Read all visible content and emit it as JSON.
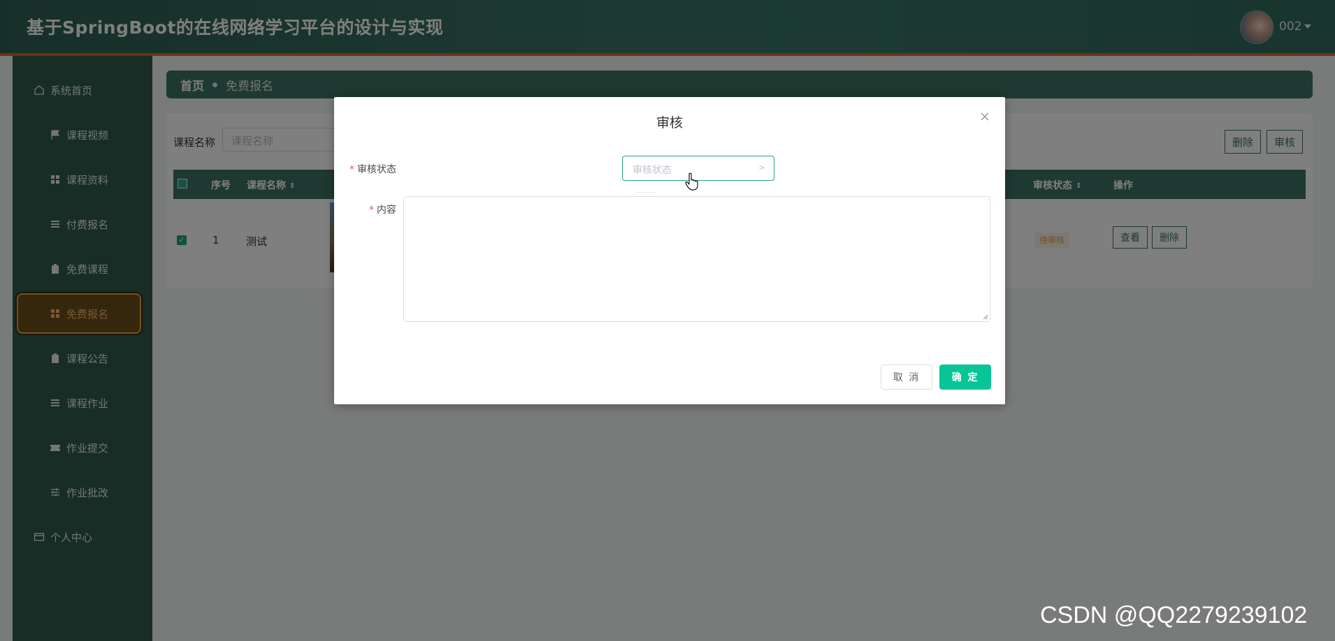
{
  "header": {
    "title": "基于SpringBoot的在线网络学习平台的设计与实现",
    "username": "002"
  },
  "sidebar": {
    "items": [
      {
        "label": "系统首页",
        "icon": "home-icon"
      },
      {
        "label": "课程视频",
        "icon": "flag-icon"
      },
      {
        "label": "课程资料",
        "icon": "grid-icon"
      },
      {
        "label": "付费报名",
        "icon": "list-icon"
      },
      {
        "label": "免费课程",
        "icon": "clipboard-icon"
      },
      {
        "label": "免费报名",
        "icon": "grid-icon",
        "active": true
      },
      {
        "label": "课程公告",
        "icon": "clipboard-icon"
      },
      {
        "label": "课程作业",
        "icon": "list-icon"
      },
      {
        "label": "作业提交",
        "icon": "ticket-icon"
      },
      {
        "label": "作业批改",
        "icon": "sliders-icon"
      },
      {
        "label": "个人中心",
        "icon": "card-icon"
      }
    ]
  },
  "breadcrumb": {
    "home": "首页",
    "current": "免费报名"
  },
  "search": {
    "label": "课程名称",
    "placeholder": "课程名称"
  },
  "toolbar": {
    "delete_label": "删除",
    "audit_label": "审核"
  },
  "table": {
    "headers": {
      "index": "序号",
      "course_name": "课程名称",
      "audit_status": "审核状态",
      "actions": "操作"
    },
    "rows": [
      {
        "index": "1",
        "course_name": "测试",
        "status": "待审核",
        "view_label": "查看",
        "delete_label": "删除"
      }
    ]
  },
  "dialog": {
    "title": "审核",
    "status_label": "审核状态",
    "status_placeholder": "审核状态",
    "content_label": "内容",
    "cancel_label": "取 消",
    "confirm_label": "确 定"
  },
  "colors": {
    "theme": "#3d7263",
    "sidebar": "#2e5b4d",
    "active_accent": "#e8a83a",
    "confirm": "#08c598",
    "required": "#e45b5b"
  },
  "watermark": "CSDN @QQ2279239102"
}
